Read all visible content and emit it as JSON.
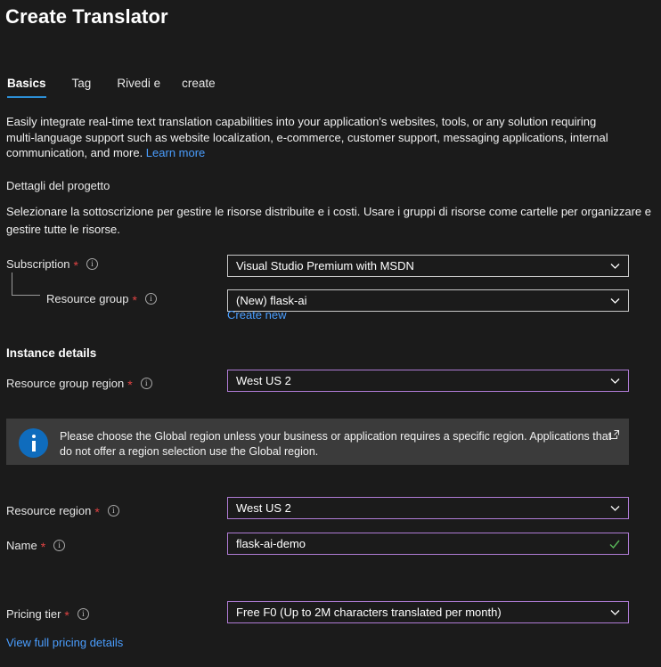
{
  "page": {
    "title": "Create Translator"
  },
  "tabs": [
    {
      "label": "Basics",
      "active": true
    },
    {
      "label": "Tag",
      "active": false
    },
    {
      "label": "Rivedi e",
      "active": false
    },
    {
      "label": "create",
      "active": false
    }
  ],
  "description": {
    "text": "Easily integrate real-time text translation capabilities into your application's websites, tools, or any solution requiring multi-language support such as website localization, e-commerce, customer support, messaging applications, internal communication, and more. ",
    "link_label": "Learn more"
  },
  "project_details": {
    "heading": "Dettagli del progetto",
    "description": "Selezionare la sottoscrizione per gestire le risorse distribuite e i costi. Usare i gruppi di risorse come cartelle per organizzare e gestire tutte le risorse."
  },
  "fields": {
    "subscription": {
      "label": "Subscription",
      "value": "Visual Studio Premium with MSDN",
      "required": true
    },
    "resource_group": {
      "label": "Resource group",
      "value": "(New) flask-ai",
      "required": true,
      "create_new_label": "Create new"
    },
    "resource_group_region": {
      "label": "Resource group region",
      "value": "West US 2",
      "required": true
    },
    "resource_region": {
      "label": "Resource region",
      "value": "West US 2",
      "required": true
    },
    "name": {
      "label": "Name",
      "value": "flask-ai-demo",
      "required": true
    },
    "pricing_tier": {
      "label": "Pricing tier",
      "value": "Free F0 (Up to 2M characters translated per month)",
      "required": true
    }
  },
  "instance_details": {
    "heading": "Instance details"
  },
  "banner": {
    "text": "Please choose the Global region unless your business or application requires a specific region. Applications that do not offer a region selection use the Global region."
  },
  "pricing_details_link": {
    "label": "View full pricing details"
  },
  "colors": {
    "background": "#1b1b1b",
    "accent_border": "#b07cd6",
    "tab_underline": "#2c8fd6",
    "link": "#4a9eff",
    "required_asterisk": "#e04343",
    "banner_background": "#3b3b3b",
    "banner_icon": "#0f6cbd",
    "valid_check": "#5ab85a"
  }
}
